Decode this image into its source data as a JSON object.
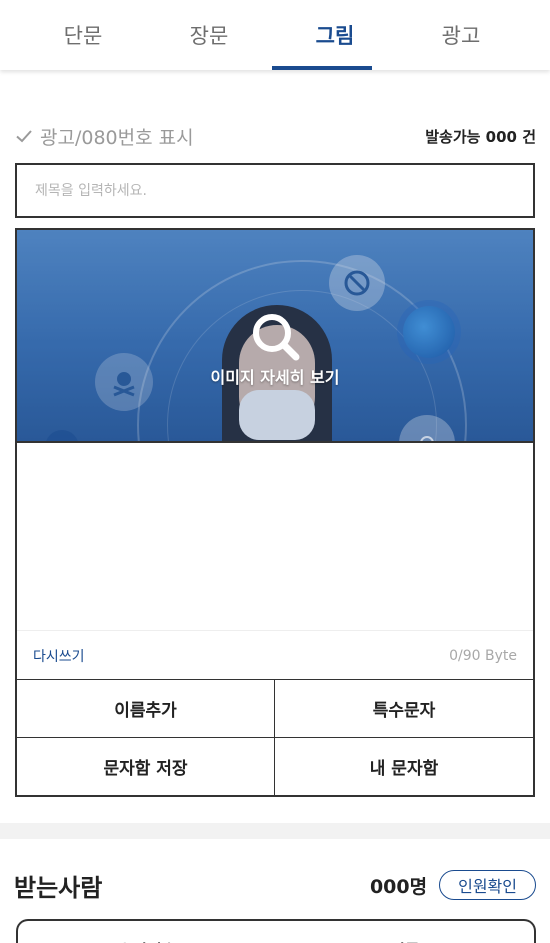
{
  "tabs": [
    {
      "label": "단문",
      "active": false
    },
    {
      "label": "장문",
      "active": false
    },
    {
      "label": "그림",
      "active": true
    },
    {
      "label": "광고",
      "active": false
    }
  ],
  "ad_option": {
    "label": "광고/080번호 표시",
    "checked": false,
    "icon": "check-icon"
  },
  "send_available": "발송가능 000 건",
  "title_field": {
    "placeholder": "제목을 입력하세요.",
    "value": ""
  },
  "image_preview": {
    "zoom_label": "이미지 자세히 보기",
    "icon": "search-icon"
  },
  "message": {
    "value": "",
    "rewrite_label": "다시쓰기",
    "byte_counter": "0/90 Byte"
  },
  "actions": {
    "add_name": "이름추가",
    "special_chars": "특수문자",
    "save_to_box": "문자함 저장",
    "my_box": "내 문자함"
  },
  "recipients": {
    "title": "받는사람",
    "count": "000명",
    "confirm_label": "인원확인",
    "columns": [
      "수신번호",
      "이름"
    ]
  },
  "colors": {
    "accent": "#1a4b8f",
    "border": "#333333",
    "muted": "#9a9a9a"
  }
}
